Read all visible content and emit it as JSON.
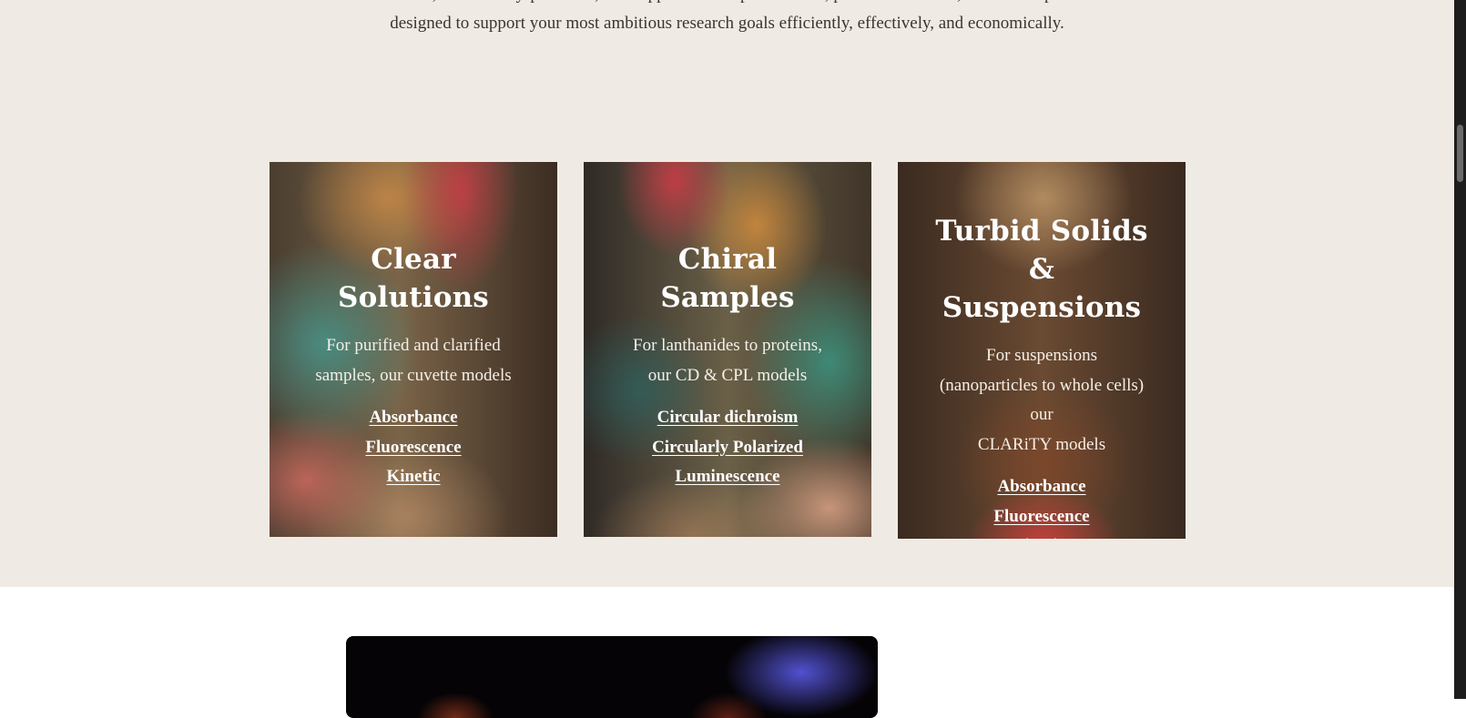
{
  "intro": {
    "line1": "Hand-crafted, individually-produced, and supported with professional, personal attention, each OLIS product is",
    "line2": "designed to support your most ambitious research goals efficiently, effectively, and economically."
  },
  "cards": [
    {
      "title": "Clear Solutions",
      "desc_line1": "For purified and clarified",
      "desc_line2": "samples, our cuvette models",
      "links": [
        "Absorbance",
        "Fluorescence",
        "Kinetic"
      ]
    },
    {
      "title": "Chiral Samples",
      "desc_line1": "For lanthanides to proteins,",
      "desc_line2": "our CD & CPL models",
      "links": [
        "Circular dichroism",
        "Circularly Polarized",
        "Luminescence"
      ]
    },
    {
      "title_line1": "Turbid Solids &",
      "title_line2": "Suspensions",
      "desc_line1": "For suspensions",
      "desc_line2": "(nanoparticles to whole cells)",
      "desc_line3": "our",
      "desc_line4": "CLARiTY models",
      "links": [
        "Absorbance",
        "Fluorescence",
        "Kinetics"
      ]
    }
  ]
}
